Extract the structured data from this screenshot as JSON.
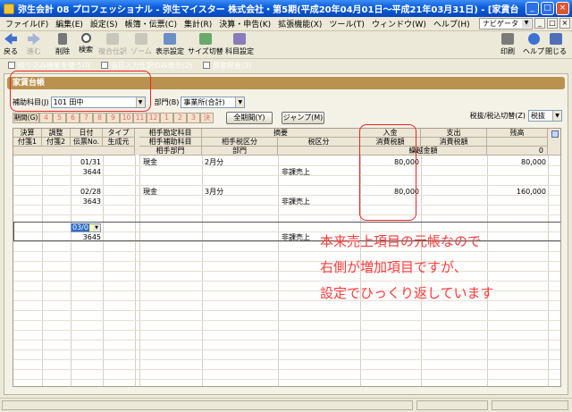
{
  "window": {
    "title": "弥生会計 08 プロフェッショナル - 弥生マイスター 株式会社・第5期(平成20年04月01日～平成21年03月31日) - [家賃台帳]",
    "controls": [
      "_",
      "□",
      "×"
    ]
  },
  "menu": {
    "items": [
      "ファイル(F)",
      "編集(E)",
      "設定(S)",
      "帳簿・伝票(C)",
      "集計(R)",
      "決算・申告(K)",
      "拡張機能(X)",
      "ツール(T)",
      "ウィンドウ(W)",
      "ヘルプ(H)"
    ],
    "navi_label": "ナビゲータ",
    "mdi_controls": [
      "_",
      "□",
      "×"
    ]
  },
  "toolbar": {
    "back": "戻る",
    "next": "進む",
    "delete": "削除",
    "search": "検索",
    "compound": "複合仕訳",
    "ream": "ゾーム",
    "display_settings": "表示設定",
    "size_switch": "サイズ切替",
    "account_settings": "科目設定",
    "print": "印刷",
    "help": "ヘルプ",
    "close": "閉じる"
  },
  "options": {
    "batch": "絞り込み機能を使う(I)",
    "today_only": "当日入力仕訳のみ表示(2)",
    "reference": "資産照会(3)"
  },
  "ledger": {
    "title": "家賃台帳",
    "sub_account_label": "補助科目(J)",
    "sub_account_value": "101 田中",
    "department_label": "部門(B)",
    "department_value": "事業所(合計)",
    "period_label": "期間(G)",
    "months": [
      "4",
      "5",
      "6",
      "7",
      "8",
      "9",
      "10",
      "11",
      "12",
      "1",
      "2",
      "3",
      "決"
    ],
    "all_period": "全期間(Y)",
    "jump": "ジャンプ(M)",
    "tax_switch_label": "税抜/税込切替(Z)",
    "tax_switch_value": "税抜"
  },
  "grid": {
    "headers": {
      "kessan": "決算",
      "chosei": "調整",
      "hizuke": "日付",
      "type": "タイプ",
      "fusen1": "付箋1",
      "fusen2": "付箋2",
      "denpyo": "伝票No.",
      "seisei": "生成元",
      "aite_kamoku": "相手勘定科目",
      "aite_hojo": "相手補助科目",
      "aite_bumon": "相手部門",
      "tekiyo": "摘要",
      "aite_zeikubun": "相手税区分",
      "bumon": "部門",
      "zeikubun": "税区分",
      "nyukin": "入金",
      "shohizei": "消費税額",
      "kurikoshi": "繰越金額",
      "shishutsu": "支出",
      "shishutsu_tax": "消費税額",
      "zandaka": "残高"
    },
    "carry": {
      "balance": "0"
    },
    "rows": [
      {
        "date": "01/31",
        "voucher": "3644",
        "account": "現金",
        "memo": "2月分",
        "tax": "非課売上",
        "income": "80,000",
        "balance": "80,000"
      },
      {
        "date": "02/28",
        "voucher": "3643",
        "account": "現金",
        "memo": "3月分",
        "tax": "非課売上",
        "income": "80,000",
        "balance": "160,000"
      },
      {
        "date": "03/0",
        "voucher": "3645",
        "account": "",
        "memo": "",
        "tax": "非課売上",
        "income": "",
        "balance": ""
      }
    ]
  },
  "annotation": {
    "line1": "本来売上項目の元帳なので",
    "line2": "右側が増加項目ですが、",
    "line3": "設定でひっくり返しています"
  },
  "colors": {
    "title_bar": "#0a5ddc",
    "section_header": "#b9924f",
    "annotation": "#ff3b3b",
    "edit_cell": "#ffffa8"
  }
}
